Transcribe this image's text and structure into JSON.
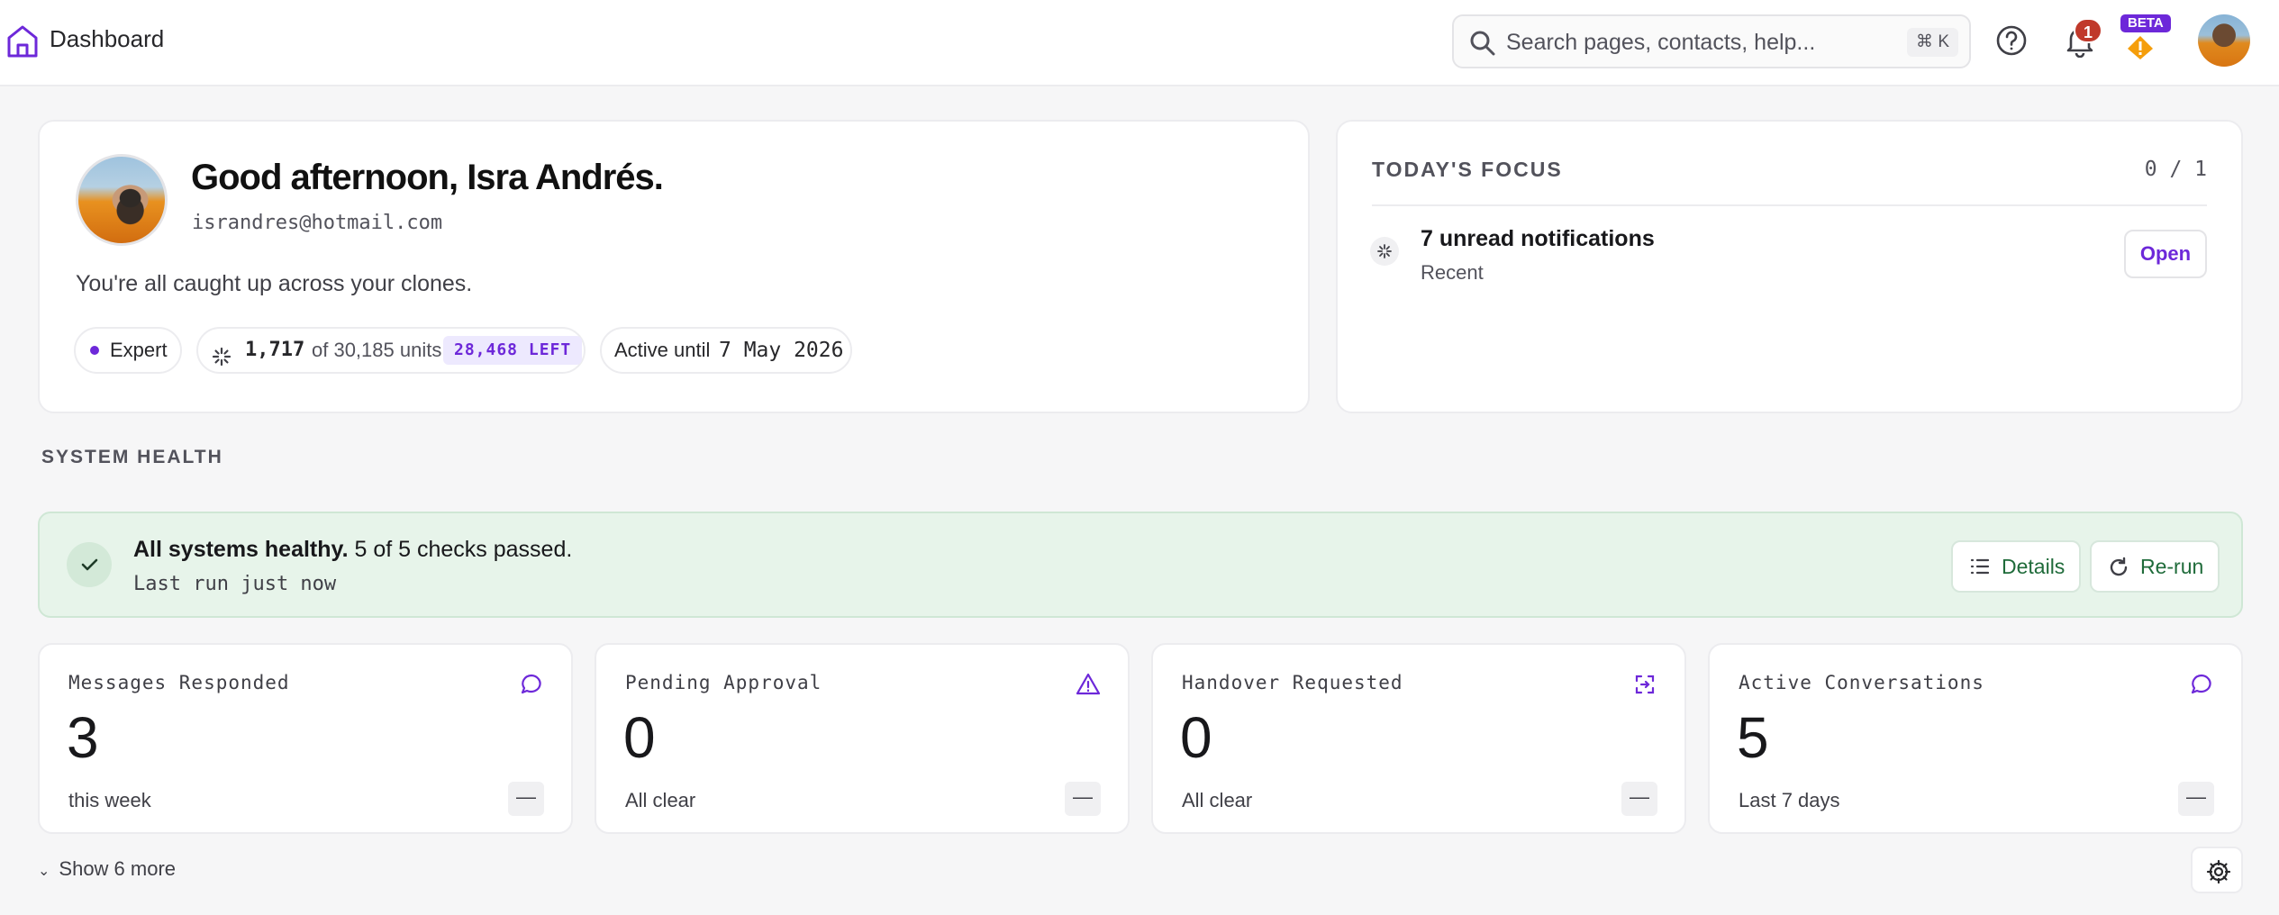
{
  "header": {
    "breadcrumb": "Dashboard",
    "search_placeholder": "Search pages, contacts, help...",
    "search_shortcut": "⌘ K",
    "notification_count": "1",
    "beta_label": "BETA"
  },
  "greeting": {
    "title": "Good afternoon, Isra Andrés.",
    "email": "israndres@hotmail.com",
    "status_text": "You're all caught up across your clones.",
    "level": "Expert",
    "units_used": "1,717",
    "units_total": "of 30,185 units",
    "units_left": "28,468 LEFT",
    "active_label": "Active until",
    "active_date": "7 May 2026"
  },
  "focus": {
    "title": "TODAY'S FOCUS",
    "count": "0 / 1",
    "item_title": "7 unread notifications",
    "item_subtitle": "Recent",
    "item_action": "Open"
  },
  "system_health": {
    "section_label": "SYSTEM HEALTH",
    "title_bold": "All systems healthy.",
    "title_rest": "5 of 5 checks passed.",
    "last_run": "Last run just now",
    "details_label": "Details",
    "rerun_label": "Re-run",
    "status_color": "#e7f4ea"
  },
  "stats": [
    {
      "label": "Messages Responded",
      "value": "3",
      "sub": "this week",
      "trend": "—",
      "icon": "chat-icon"
    },
    {
      "label": "Pending Approval",
      "value": "0",
      "sub": "All clear",
      "trend": "—",
      "icon": "warning-icon"
    },
    {
      "label": "Handover Requested",
      "value": "0",
      "sub": "All clear",
      "trend": "—",
      "icon": "handover-icon"
    },
    {
      "label": "Active Conversations",
      "value": "5",
      "sub": "Last 7 days",
      "trend": "—",
      "icon": "chat-icon"
    }
  ],
  "footer": {
    "show_more": "Show 6 more"
  },
  "colors": {
    "accent": "#6d28d9",
    "success": "#1f6b3a",
    "alert": "#c0392b",
    "warning": "#f59e0b"
  }
}
